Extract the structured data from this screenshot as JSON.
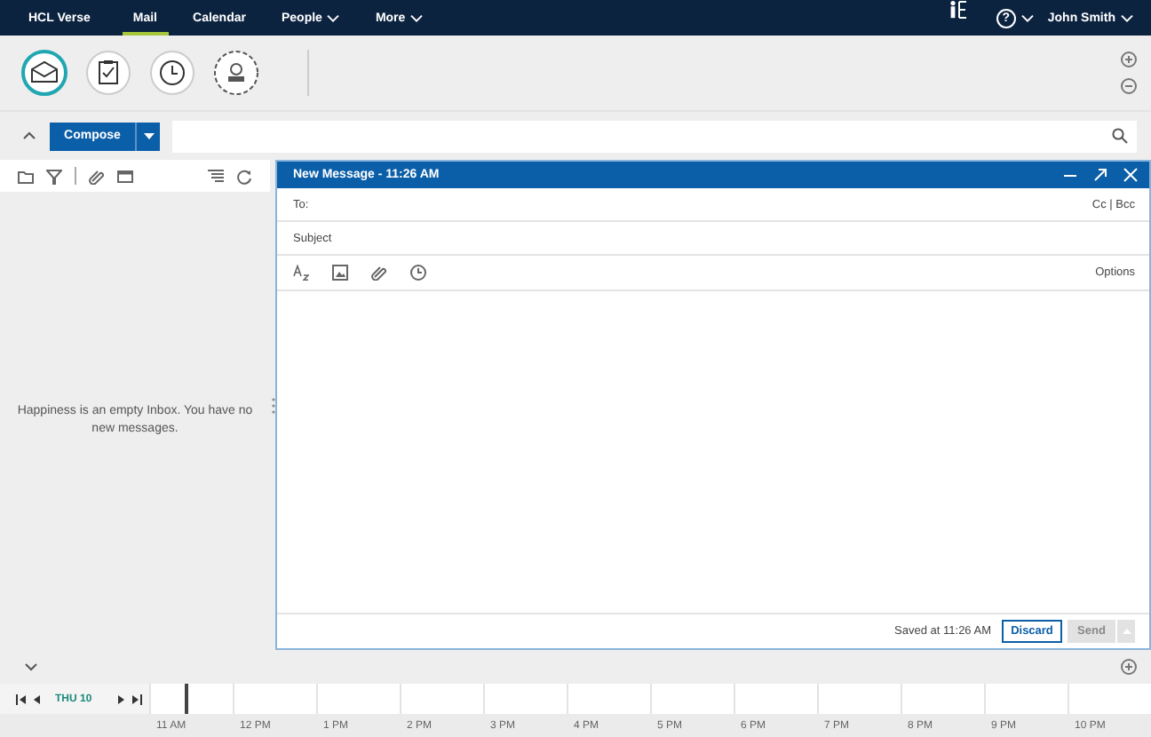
{
  "nav": {
    "brand": "HCL Verse",
    "tabs": [
      {
        "label": "Mail",
        "selected": true,
        "menu": false
      },
      {
        "label": "Calendar",
        "selected": false,
        "menu": false
      },
      {
        "label": "People",
        "selected": false,
        "menu": true
      },
      {
        "label": "More",
        "selected": false,
        "menu": true
      }
    ],
    "help": "?",
    "user": "John Smith"
  },
  "launcher": [
    {
      "kind": "mail",
      "selected": true
    },
    {
      "kind": "tasks",
      "selected": false
    },
    {
      "kind": "clock",
      "selected": false
    },
    {
      "kind": "person",
      "selected": false
    }
  ],
  "actionbar": {
    "compose": "Compose"
  },
  "inbox": {
    "empty_message": "Happiness is an empty Inbox. You have no new messages."
  },
  "composer": {
    "title": "New Message - 11:26 AM",
    "to_label": "To:",
    "cc_bcc": "Cc | Bcc",
    "subject_placeholder": "Subject",
    "options": "Options",
    "saved": "Saved at 11:26 AM",
    "discard": "Discard",
    "send": {
      "label": "Send",
      "disabled": true
    }
  },
  "timeline": {
    "day": "THU 10",
    "hours": [
      "11 AM",
      "12 PM",
      "1 PM",
      "2 PM",
      "3 PM",
      "4 PM",
      "5 PM",
      "6 PM",
      "7 PM",
      "8 PM",
      "9 PM",
      "10 PM"
    ]
  }
}
